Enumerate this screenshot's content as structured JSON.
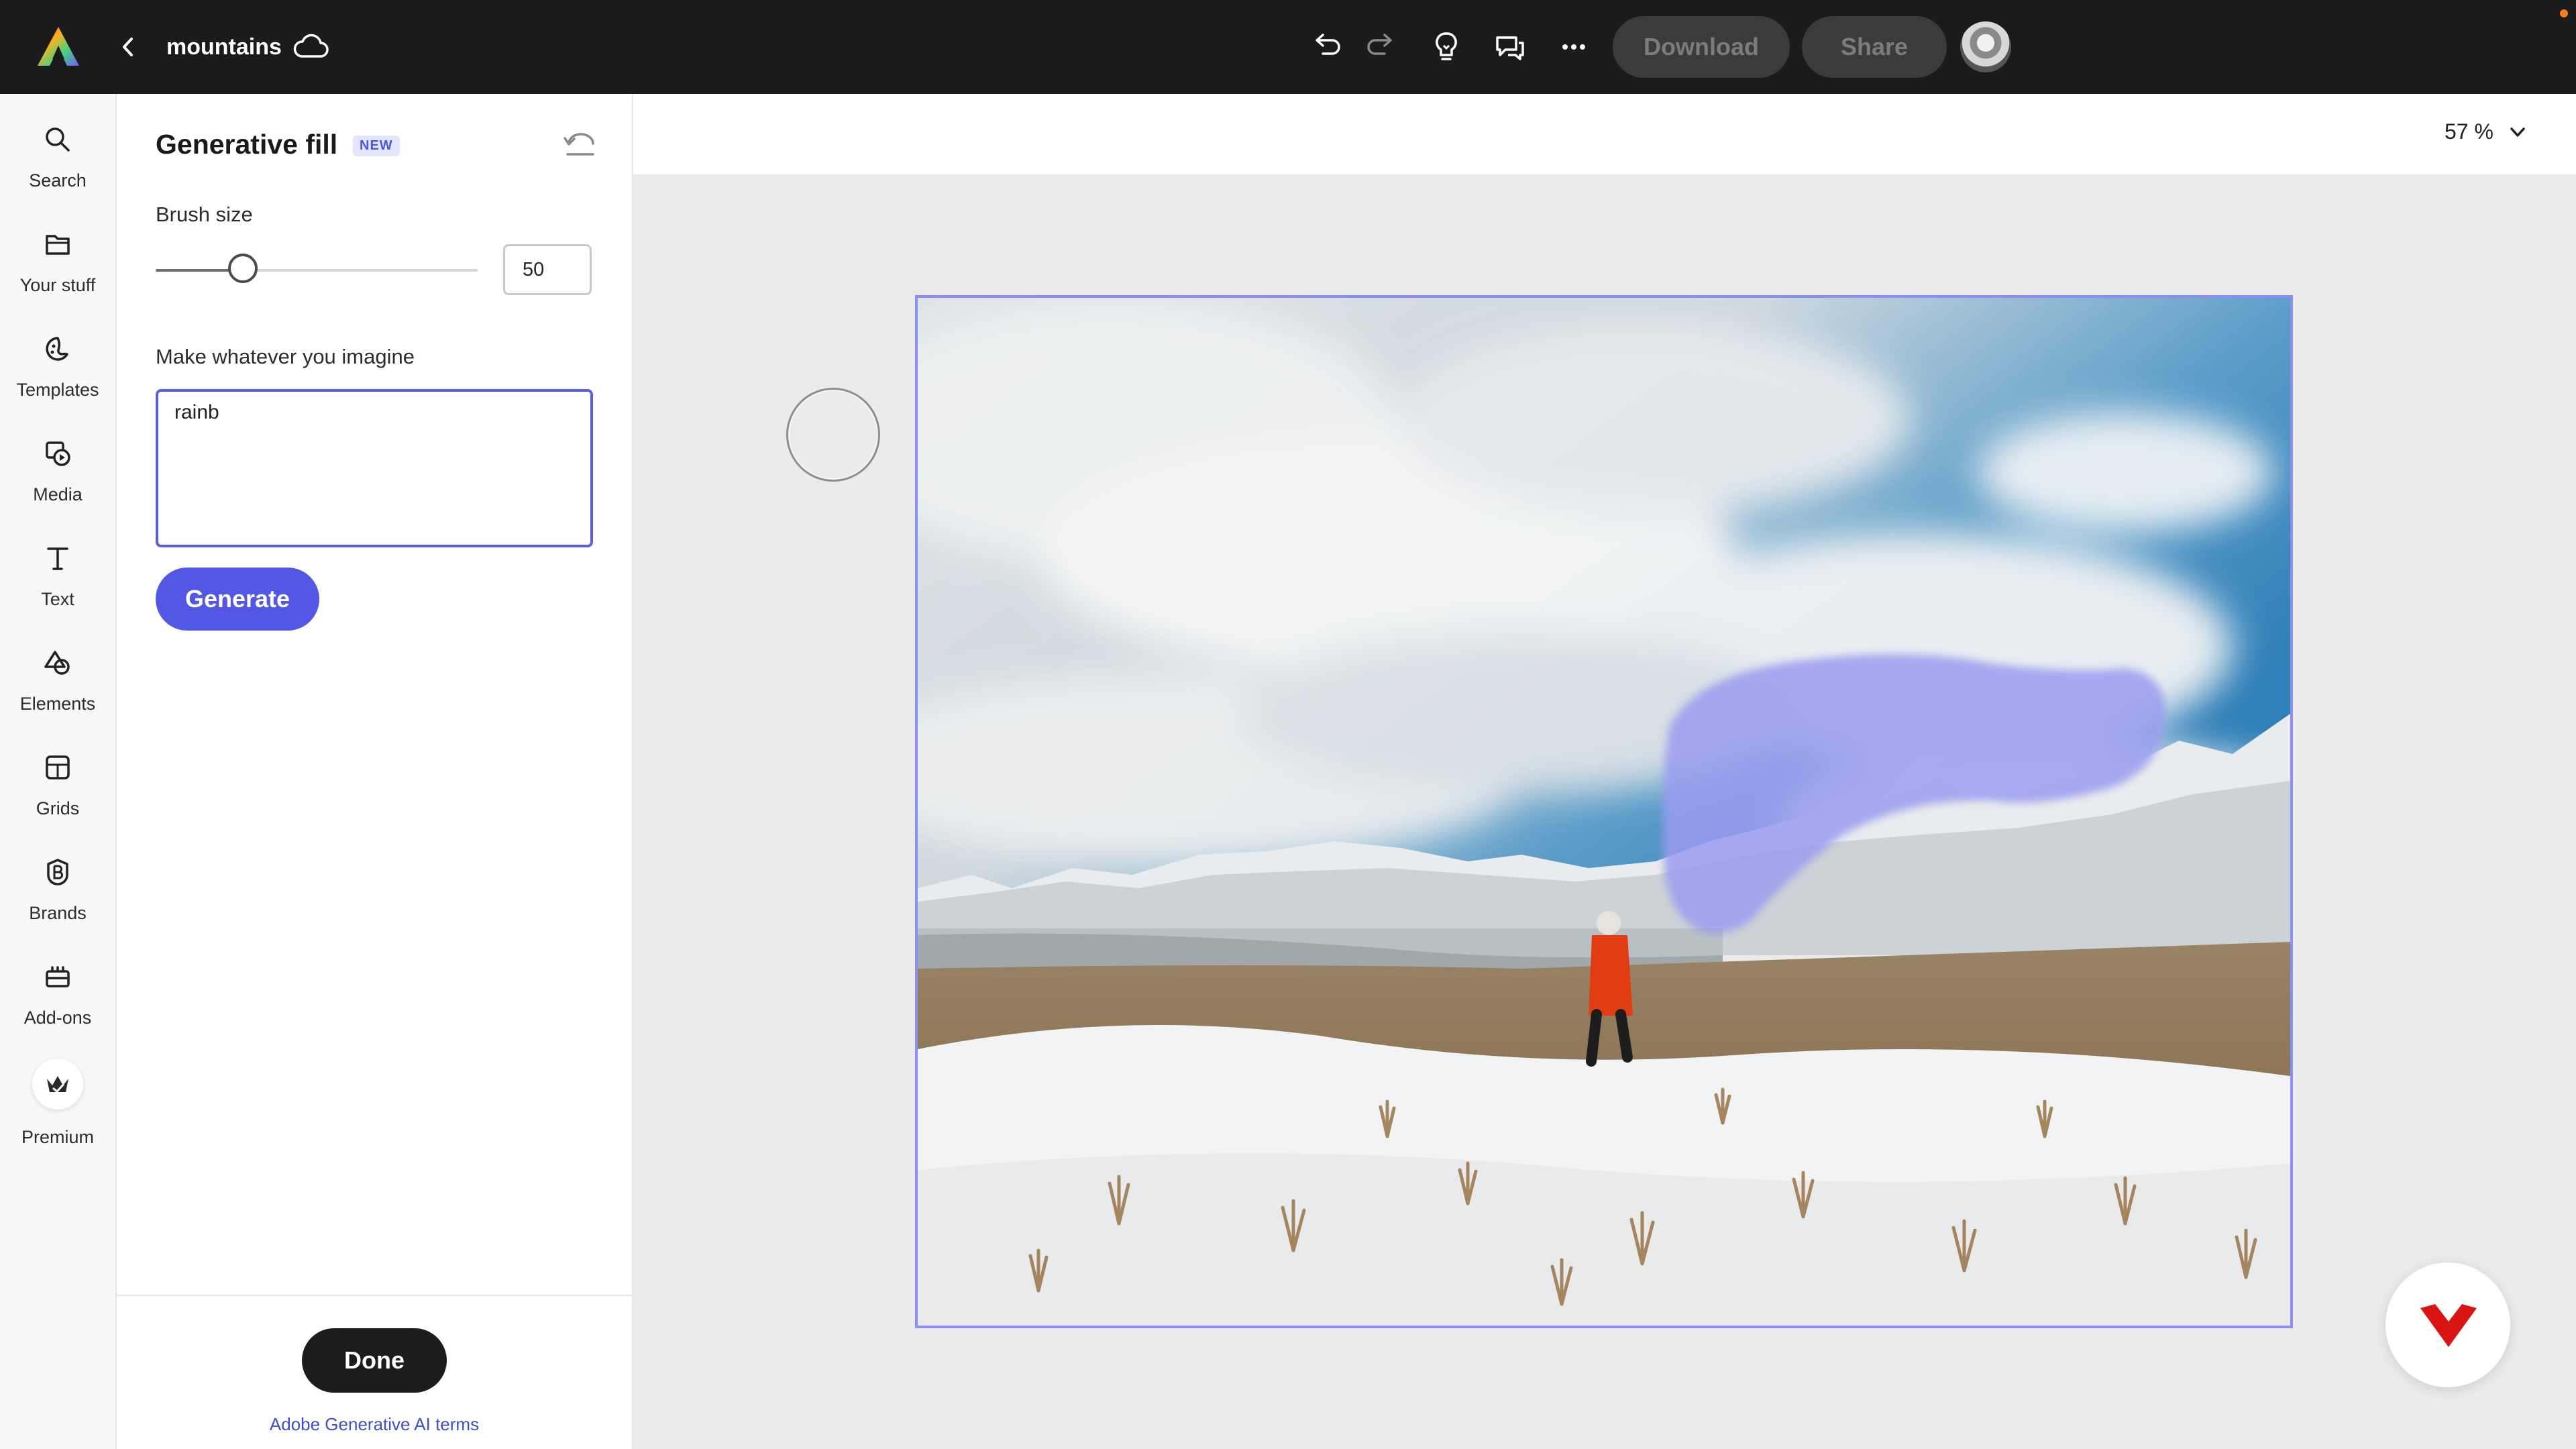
{
  "app": {
    "document_name": "mountains"
  },
  "toolbar": {
    "download_label": "Download",
    "share_label": "Share",
    "icons": [
      "undo-icon",
      "redo-icon",
      "lightbulb-icon",
      "comments-icon",
      "more-icon",
      "cloud-icon",
      "back-chevron-icon"
    ]
  },
  "rail": {
    "items": [
      {
        "label": "Search",
        "icon": "search-icon"
      },
      {
        "label": "Your stuff",
        "icon": "folder-icon"
      },
      {
        "label": "Templates",
        "icon": "templates-icon"
      },
      {
        "label": "Media",
        "icon": "media-icon"
      },
      {
        "label": "Text",
        "icon": "text-icon"
      },
      {
        "label": "Elements",
        "icon": "elements-icon"
      },
      {
        "label": "Grids",
        "icon": "grids-icon"
      },
      {
        "label": "Brands",
        "icon": "brands-icon"
      },
      {
        "label": "Add-ons",
        "icon": "add-ons-icon"
      },
      {
        "label": "Premium",
        "icon": "premium-crown-icon"
      }
    ]
  },
  "panel": {
    "title": "Generative fill",
    "badge": "NEW",
    "brush_size_label": "Brush size",
    "brush_size_value": "50",
    "brush_slider_fraction": 0.27,
    "prompt_label": "Make whatever you imagine",
    "prompt_value": "rainb",
    "generate_label": "Generate",
    "done_label": "Done",
    "terms_link": "Adobe Generative AI terms"
  },
  "canvas": {
    "zoom": "57 %"
  },
  "colors": {
    "accent": "#5258e4",
    "topbar": "#1b1b1b",
    "mask": "#9a9cf0"
  }
}
